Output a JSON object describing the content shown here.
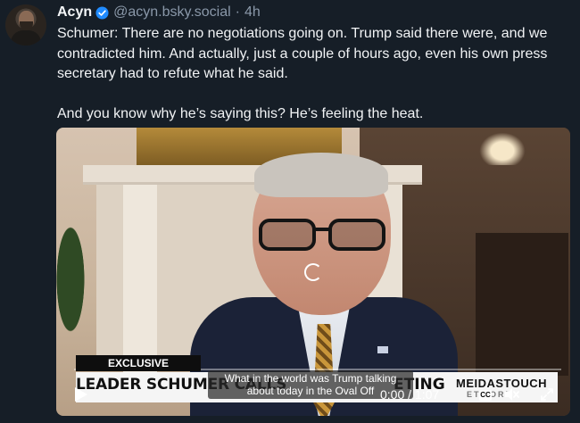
{
  "author": {
    "name": "Acyn",
    "handle": "@acyn.bsky.social",
    "separator": "·",
    "time": "4h"
  },
  "post": {
    "paragraph_1": "Schumer: There are no negotiations going on. Trump said there were, and we contradicted him. And actually, just a couple of hours ago, even his own press secretary had to refute what he said.",
    "paragraph_2": "And you know why he’s saying this? He’s feeling the heat."
  },
  "video": {
    "badge": "EXCLUSIVE",
    "headline": "LEADER SCHUMER CALLS",
    "headline_tail": "ETING",
    "brand_name": "MEIDASTOUCH",
    "brand_sub": "ETWORK",
    "caption_line_1": "What in the world was Trump talking",
    "caption_line_2": "about today in the Oval Off",
    "time_current": "0:00",
    "time_separator": "/",
    "time_total": "1:07",
    "cc_label": "CC",
    "progress": 0
  },
  "colors": {
    "background": "#161e27",
    "verified": "#208bfe",
    "muted_text": "#8a98a9"
  },
  "icons": {
    "verified": "verified-badge-icon",
    "play": "play-icon",
    "mute": "muted-speaker-icon",
    "fullscreen": "fullscreen-icon",
    "loading": "loading-spinner-icon"
  }
}
